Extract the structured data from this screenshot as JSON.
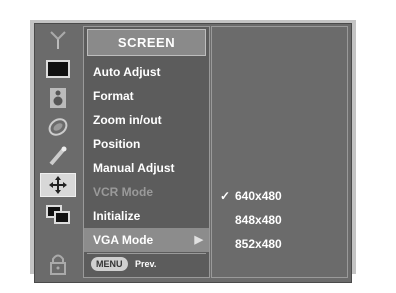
{
  "menu": {
    "title": "SCREEN",
    "items": [
      {
        "label": "Auto Adjust",
        "state": "normal"
      },
      {
        "label": "Format",
        "state": "normal"
      },
      {
        "label": "Zoom in/out",
        "state": "normal"
      },
      {
        "label": "Position",
        "state": "normal"
      },
      {
        "label": "Manual Adjust",
        "state": "normal"
      },
      {
        "label": "VCR Mode",
        "state": "disabled"
      },
      {
        "label": "Initialize",
        "state": "normal"
      },
      {
        "label": "VGA Mode",
        "state": "active",
        "arrow": "▶"
      }
    ],
    "footer": {
      "button_label": "MENU",
      "prev_label": "Prev."
    }
  },
  "submenu": {
    "options": [
      {
        "label": "640x480",
        "selected": true,
        "mark": "✓"
      },
      {
        "label": "848x480",
        "selected": false,
        "mark": ""
      },
      {
        "label": "852x480",
        "selected": false,
        "mark": ""
      }
    ]
  },
  "icons": [
    "antenna-icon",
    "picture-icon",
    "speaker-icon",
    "clock-icon",
    "brush-icon",
    "screen-move-icon",
    "pip-icon",
    "lock-icon"
  ]
}
